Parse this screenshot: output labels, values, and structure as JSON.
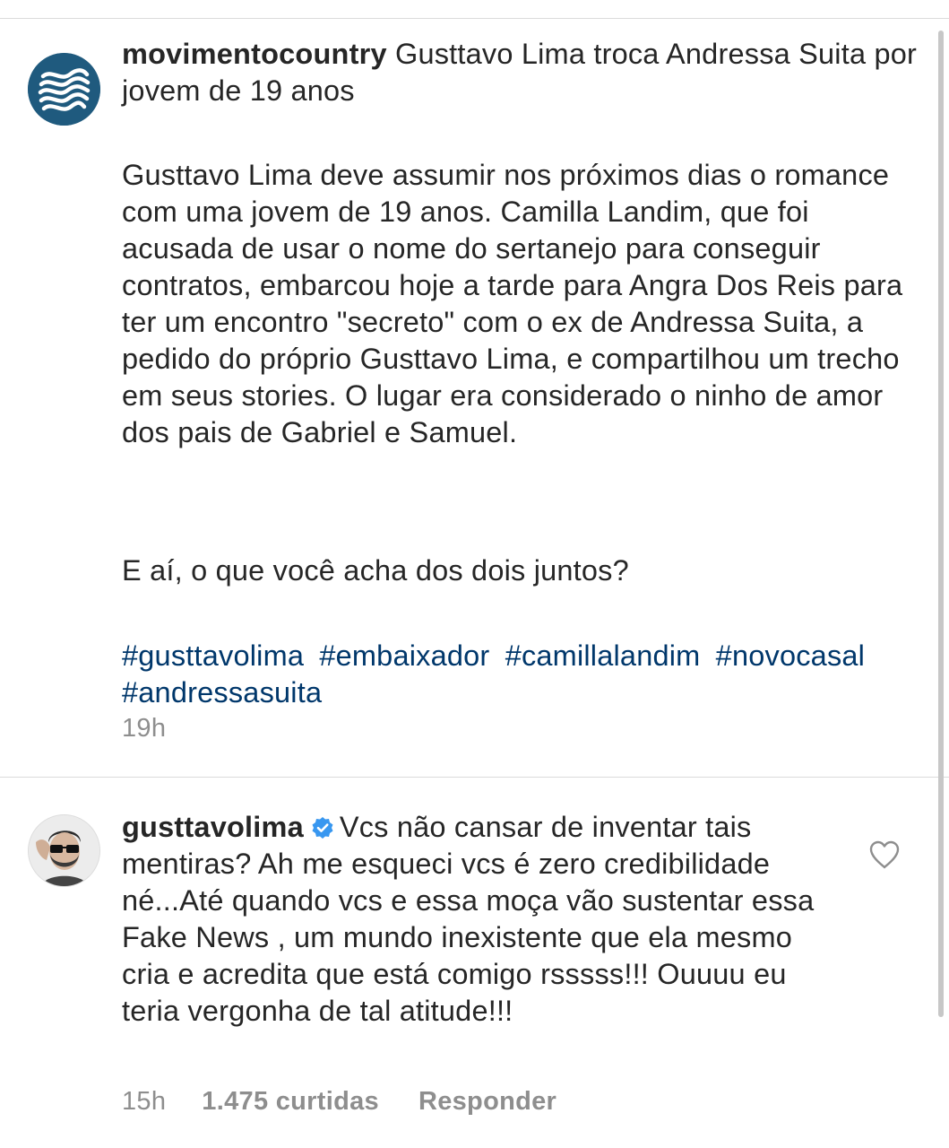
{
  "post_caption": {
    "username": "movimentocountry",
    "headline": "Gusttavo Lima troca Andressa Suita por jovem de 19 anos",
    "body": "Gusttavo Lima deve assumir nos próximos dias o romance com uma jovem de 19 anos. Camilla Landim, que foi acusada de usar o nome do sertanejo para conseguir contratos, embarcou hoje a tarde para Angra Dos Reis para ter um encontro \"secreto\" com o ex de Andressa Suita, a pedido do próprio Gusttavo Lima, e compartilhou um trecho em seus stories. O lugar era considerado o ninho de amor dos pais de Gabriel e Samuel.",
    "question": "E aí, o que você acha dos dois juntos?",
    "hashtags": [
      "#gusttavolima",
      "#embaixador",
      "#camillalandim",
      "#novocasal",
      "#andressasuita"
    ],
    "time": "19h",
    "avatar_icon": "waves-logo-icon",
    "avatar_color": "#1f5a7e"
  },
  "comment": {
    "username": "gusttavolima",
    "verified": true,
    "verified_icon": "verified-badge-icon",
    "text": "Vcs não cansar de inventar tais mentiras? Ah me esqueci vcs é zero credibilidade né...Até quando vcs e essa moça vão sustentar essa Fake News , um mundo inexistente que ela mesmo cria e acredita que está comigo rsssss!!! Ouuuu eu teria vergonha de tal atitude!!!",
    "time": "15h",
    "likes": "1.475 curtidas",
    "reply_label": "Responder",
    "like_icon": "heart-outline-icon",
    "avatar_icon": "user-photo-avatar"
  },
  "colors": {
    "text": "#262626",
    "meta": "#8e8e8e",
    "hashtag": "#00376b",
    "verified": "#3897f0",
    "divider": "#dbdbdb"
  }
}
